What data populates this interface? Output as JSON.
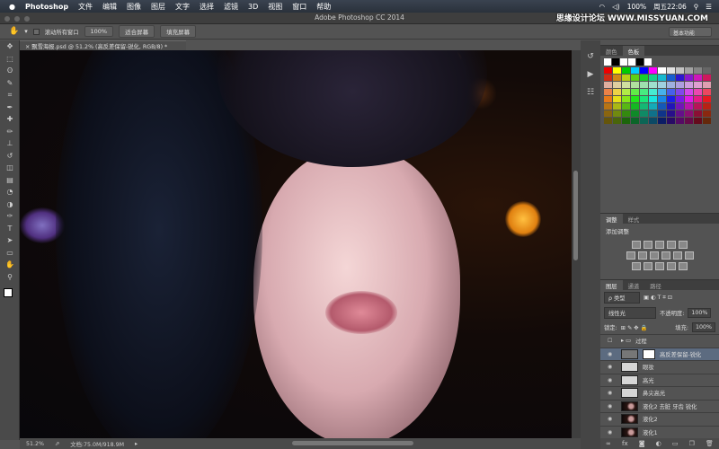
{
  "menubar": {
    "app": "Photoshop",
    "items": [
      "文件",
      "编辑",
      "图像",
      "图层",
      "文字",
      "选择",
      "滤镜",
      "3D",
      "视图",
      "窗口",
      "帮助"
    ],
    "battery": "100%",
    "clock": "周五22:06"
  },
  "titlebar": {
    "title": "Adobe Photoshop CC 2014",
    "watermark": "思缘设计论坛 WWW.MISSYUAN.COM"
  },
  "options": {
    "scroll_all": "滚动所有窗口",
    "zoom100": "100%",
    "fit_screen": "适合屏幕",
    "fill_screen": "填充屏幕",
    "workspace": "基本功能"
  },
  "document": {
    "tab": "飘雪海报.psd @ 51.2% (高反差保留-锐化, RGB/8) *"
  },
  "status": {
    "zoom": "51.2%",
    "doc_size": "文档:75.0M/918.9M"
  },
  "swatches": {
    "tabs": [
      "颜色",
      "色板"
    ]
  },
  "adjustments": {
    "tabs": [
      "调整",
      "样式"
    ],
    "heading": "添加调整"
  },
  "layers": {
    "tabs": [
      "图层",
      "通道",
      "路径"
    ],
    "filter": "ρ 类型",
    "blend": "线性光",
    "opacity_label": "不透明度:",
    "opacity": "100%",
    "lock_label": "锁定:",
    "fill_label": "填充:",
    "fill": "100%",
    "items": [
      {
        "name": "过程",
        "type": "group",
        "visible": false
      },
      {
        "name": "高反差保留-锐化",
        "type": "mask",
        "visible": true,
        "selected": true
      },
      {
        "name": "眼妆",
        "type": "blank",
        "visible": true
      },
      {
        "name": "高光",
        "type": "blank",
        "visible": true
      },
      {
        "name": "鼻尖高光",
        "type": "blank",
        "visible": true
      },
      {
        "name": "液化2 去脏 牙齿 锐化",
        "type": "photo",
        "visible": true
      },
      {
        "name": "液化2",
        "type": "photo",
        "visible": true
      },
      {
        "name": "液化1",
        "type": "photo",
        "visible": true
      }
    ]
  }
}
